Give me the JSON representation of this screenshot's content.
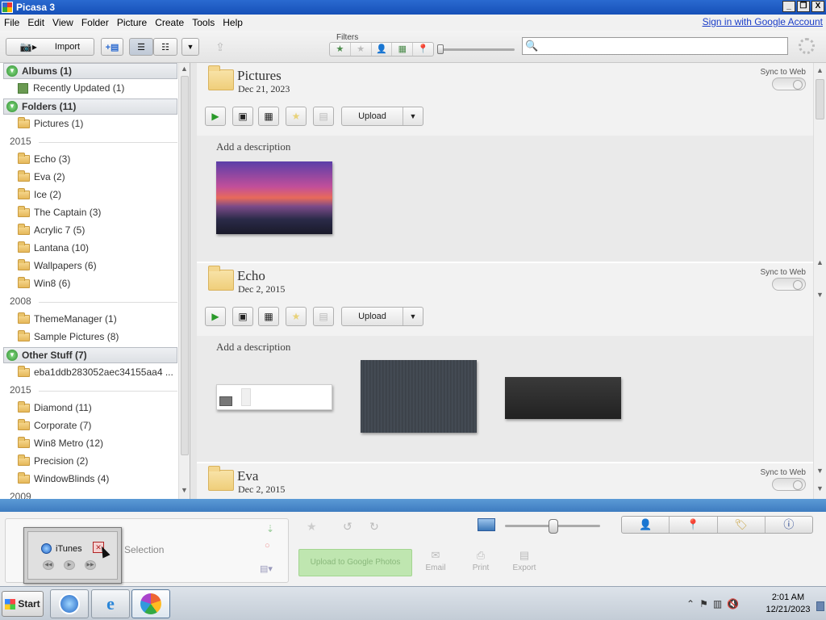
{
  "window": {
    "title": "Picasa 3",
    "min_label": "_",
    "max_label": "❐",
    "close_label": "X"
  },
  "menu": {
    "items": [
      "File",
      "Edit",
      "View",
      "Folder",
      "Picture",
      "Create",
      "Tools",
      "Help"
    ],
    "signin": "Sign in with Google Account"
  },
  "toolbar": {
    "import_label": "Import",
    "filters_label": "Filters",
    "search_placeholder": "",
    "search_value": ""
  },
  "left": {
    "albums_header": "Albums (1)",
    "albums": [
      {
        "label": "Recently Updated (1)"
      }
    ],
    "folders_header": "Folders (11)",
    "folders_top": [
      {
        "label": "Pictures (1)"
      }
    ],
    "year_2015a": "2015",
    "folders_2015": [
      {
        "label": "Echo (3)"
      },
      {
        "label": "Eva (2)"
      },
      {
        "label": "Ice (2)"
      },
      {
        "label": "The Captain (3)"
      },
      {
        "label": "Acrylic 7 (5)"
      },
      {
        "label": "Lantana (10)"
      },
      {
        "label": "Wallpapers (6)"
      },
      {
        "label": "Win8 (6)"
      }
    ],
    "year_2008": "2008",
    "folders_2008": [
      {
        "label": "ThemeManager (1)"
      },
      {
        "label": "Sample Pictures (8)"
      }
    ],
    "other_header": "Other Stuff (7)",
    "other_top": [
      {
        "label": "eba1ddb283052aec34155aa4 ..."
      }
    ],
    "year_2015b": "2015",
    "other_2015": [
      {
        "label": "Diamond (11)"
      },
      {
        "label": "Corporate (7)"
      },
      {
        "label": "Win8 Metro (12)"
      },
      {
        "label": "Precision (2)"
      },
      {
        "label": "WindowBlinds (4)"
      }
    ],
    "year_2009": "2009"
  },
  "main": {
    "sync_label": "Sync to Web",
    "upload_label": "Upload",
    "description_placeholder": "Add a description",
    "folders": [
      {
        "title": "Pictures",
        "date": "Dec 21, 2023"
      },
      {
        "title": "Echo",
        "date": "Dec 2, 2015"
      },
      {
        "title": "Eva",
        "date": "Dec 2, 2015"
      }
    ]
  },
  "tray": {
    "selection_label": "Selection",
    "itunes_label": "iTunes",
    "green_button": "Upload to Google Photos",
    "email": "Email",
    "print": "Print",
    "export": "Export"
  },
  "taskbar": {
    "start_label": "Start",
    "time": "2:01 AM",
    "date": "12/21/2023"
  },
  "colors": {
    "titlebar": "#1650b8",
    "divider": "#4a88c8",
    "link": "#1a3dc8"
  }
}
